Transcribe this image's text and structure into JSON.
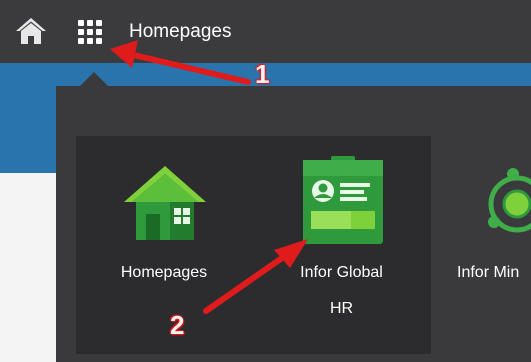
{
  "header": {
    "title": "Homepages",
    "home_icon": "home-icon",
    "apps_icon": "app-grid-icon"
  },
  "apps": [
    {
      "label_line1": "Homepages",
      "label_line2": "",
      "icon": "house-icon"
    },
    {
      "label_line1": "Infor Global",
      "label_line2": "HR",
      "icon": "id-badge-icon"
    },
    {
      "label_line1": "Infor Min",
      "label_line2": "",
      "icon": "network-icon"
    }
  ],
  "annotations": {
    "step1": "1",
    "step2": "2",
    "color": "#e01b1b"
  },
  "colors": {
    "topbar": "#3b3b3d",
    "panel": "#3a3a3c",
    "accent_blue": "#2a74ae",
    "green": "#3fae49"
  }
}
